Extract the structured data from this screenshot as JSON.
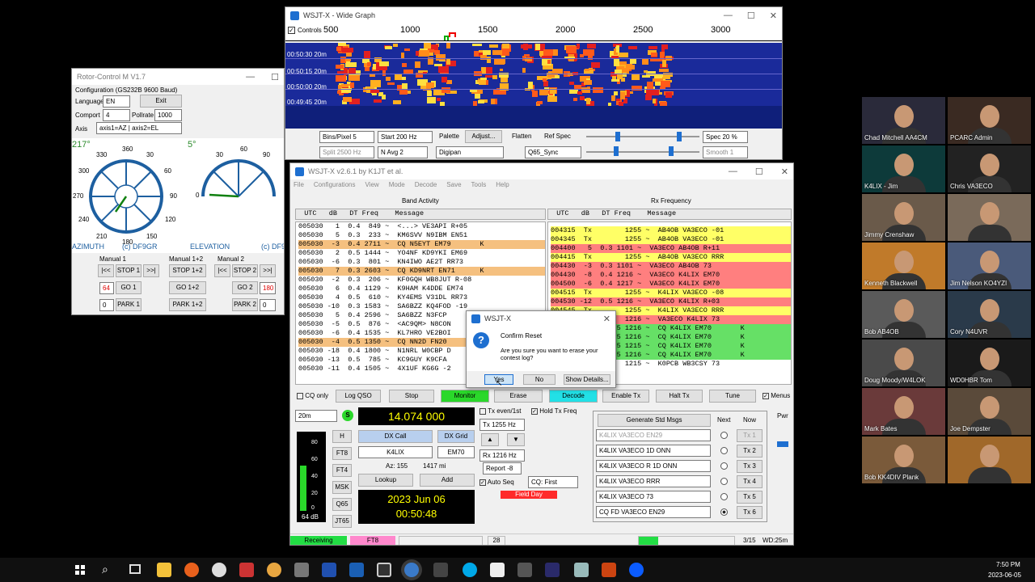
{
  "colors": {
    "row_orange": "#f5c07f",
    "row_yellow": "#ffff66",
    "row_red": "#ff7f7f",
    "row_green": "#66e066",
    "monitor_green": "#2ad82a",
    "decode_cyan": "#22e0e6",
    "field_day_red": "#ff2a2a",
    "receiving_green": "#22dd44",
    "ft8_pink": "#ff88cc",
    "freq_yellow": "#ffff00"
  },
  "widegraph": {
    "title": "WSJT-X - Wide Graph",
    "controls_label": "Controls",
    "scale": [
      "500",
      "1000",
      "1500",
      "2000",
      "2500",
      "3000"
    ],
    "time_labels": [
      "00:50:30  20m",
      "00:50:15  20m",
      "00:50:00  20m",
      "00:49:45  20m"
    ],
    "bins_label": "Bins/Pixel  5",
    "start_label": "Start 200 Hz",
    "palette_label": "Palette",
    "adjust_label": "Adjust...",
    "flatten_label": "Flatten",
    "refspec_label": "Ref Spec",
    "spec_label": "Spec 20 %",
    "split_label": "Split  2500 Hz",
    "navg_label": "N Avg  2",
    "digipan_label": "Digipan",
    "q65_label": "Q65_Sync",
    "smooth_label": "Smooth  1"
  },
  "rotor": {
    "title": "Rotor-Control M V1.7",
    "config": "Configuration (GS232B 9600 Baud)",
    "language_label": "Language",
    "language_value": "EN",
    "exit_label": "Exit",
    "comport_label": "Comport",
    "comport_value": "4",
    "pollrate_label": "Pollrate",
    "pollrate_value": "1000",
    "axis_label": "Axis",
    "axis_value": "axis1=AZ | axis2=EL",
    "az_value": "217°",
    "el_value": "5°",
    "az_ticks": [
      "360",
      "30",
      "60",
      "90",
      "120",
      "150",
      "180",
      "210",
      "240",
      "270",
      "300",
      "330"
    ],
    "el_ticks": [
      "30",
      "60",
      "90",
      "0"
    ],
    "el_right_tick": "0",
    "azimuth_label": "AZIMUTH",
    "copyright1": "(c) DF9GR",
    "elevation_label": "ELEVATION",
    "copyright2": "(c) DF9",
    "manual1": "Manual 1",
    "manual12": "Manual 1+2",
    "manual2": "Manual 2",
    "back_btn": "|<<",
    "fwd_btn": ">>|",
    "stop1": "STOP 1",
    "stop12": "STOP 1+2",
    "stop2": "STOP 2",
    "go1": "GO 1",
    "go12": "GO 1+2",
    "go2": "GO 2",
    "park1": "PARK 1",
    "park12": "PARK 1+2",
    "park2": "PARK 2",
    "val64": "64",
    "val180": "180",
    "val0a": "0",
    "val0b": "0"
  },
  "wsjtx": {
    "title": "WSJT-X  v2.6.1  by K1JT et al.",
    "menu": [
      "File",
      "Configurations",
      "View",
      "Mode",
      "Decode",
      "Save",
      "Tools",
      "Help"
    ],
    "band_activity": "Band Activity",
    "rx_frequency": "Rx Frequency",
    "header": "  UTC   dB   DT Freq    Message",
    "left_rows": [
      {
        "t": "005030   1  0.4  849 ~  <...> VE3API R+05",
        "c": "w"
      },
      {
        "t": "005030   5  0.3  233 ~  KM6SVV N9IBM EN51",
        "c": "w"
      },
      {
        "t": "005030  -3  0.4 2711 ~  CQ N5EYT EM79       K",
        "c": "o"
      },
      {
        "t": "005030   2  0.5 1444 ~  YO4NF KD9YKI EM69",
        "c": "w"
      },
      {
        "t": "005030  -6  0.3  801 ~  KN4IWO AE2T RR73",
        "c": "w"
      },
      {
        "t": "005030   7  0.3 2603 ~  CQ KD9NRT EN71      K",
        "c": "o"
      },
      {
        "t": "005030  -2  0.3  206 ~  KF0GQH WB8JUT R-08",
        "c": "w"
      },
      {
        "t": "005030   6  0.4 1129 ~  K9HAM K4DDE EM74",
        "c": "w"
      },
      {
        "t": "005030   4  0.5  610 ~  KY4EMS V31DL RR73",
        "c": "w"
      },
      {
        "t": "005030 -10  0.3 1583 ~  SA6BZZ KQ4FOD -19",
        "c": "w"
      },
      {
        "t": "005030   5  0.4 2596 ~  SA6BZZ N3FCP",
        "c": "w"
      },
      {
        "t": "005030  -5  0.5  876 ~  <AC9QM> N8CON",
        "c": "w"
      },
      {
        "t": "005030  -6  0.4 1535 ~  KL7HRO VE2BOI",
        "c": "w"
      },
      {
        "t": "005030  -4  0.5 1350 ~  CQ NN2D FN20",
        "c": "o"
      },
      {
        "t": "005030 -18  0.4 1800 ~  N1NRL W0CBP D",
        "c": "w"
      },
      {
        "t": "005030 -13  0.5  785 ~  KC9GUY K9CFA",
        "c": "w"
      },
      {
        "t": "005030 -11  0.4 1505 ~  4X1UF KG6G -2",
        "c": "w"
      }
    ],
    "right_rows": [
      {
        "t": "004315  Tx        1255 ~  AB4OB VA3ECO -01",
        "c": "y"
      },
      {
        "t": "004345  Tx        1255 ~  AB4OB VA3ECO -01",
        "c": "y"
      },
      {
        "t": "004400   5  0.3 1101 ~  VA3ECO AB4OB R+11",
        "c": "r"
      },
      {
        "t": "004415  Tx        1255 ~  AB4OB VA3ECO RRR",
        "c": "y"
      },
      {
        "t": "004430  -3  0.3 1101 ~  VA3ECO AB4OB 73",
        "c": "r"
      },
      {
        "t": "004430  -8  0.4 1216 ~  VA3ECO K4LIX EM70",
        "c": "r"
      },
      {
        "t": "004500  -6  0.4 1217 ~  VA3ECO K4LIX EM70",
        "c": "r"
      },
      {
        "t": "004515  Tx        1255 ~  K4LIX VA3ECO -08",
        "c": "y"
      },
      {
        "t": "004530 -12  0.5 1216 ~  VA3ECO K4LIX R+03",
        "c": "r"
      },
      {
        "t": "004545  Tx        1255 ~  K4LIX VA3ECO RRR",
        "c": "y"
      },
      {
        "t": "                  1216 ~  VA3ECO K4LIX 73",
        "c": "r"
      },
      {
        "t": "                5 1216 ~  CQ K4LIX EM70       K",
        "c": "g"
      },
      {
        "t": "                5 1216 ~  CQ K4LIX EM70       K",
        "c": "g"
      },
      {
        "t": "                5 1215 ~  CQ K4LIX EM70       K",
        "c": "g"
      },
      {
        "t": "                5 1216 ~  CQ K4LIX EM70       K",
        "c": "g"
      },
      {
        "t": "                  1215 ~  K0PCB WB3CSY 73",
        "c": "w"
      }
    ],
    "cq_only": "CQ only",
    "log_qso": "Log QSO",
    "stop": "Stop",
    "monitor": "Monitor",
    "erase": "Erase",
    "decode": "Decode",
    "enable_tx": "Enable Tx",
    "halt_tx": "Halt Tx",
    "tune": "Tune",
    "menus": "Menus",
    "band": "20m",
    "freq": "14.074 000",
    "tx_even": "Tx even/1st",
    "hold_tx": "Hold Tx Freq",
    "tx_freq": "Tx  1255 Hz",
    "rx_freq": "Rx  1216 Hz",
    "report": "Report  -8",
    "auto_seq": "Auto Seq",
    "cq_first": "CQ: First",
    "field_day": "Field Day",
    "h_btn": "H",
    "ft8_btn": "FT8",
    "ft4_btn": "FT4",
    "msk_btn": "MSK",
    "q65_btn": "Q65",
    "jt65_btn": "JT65",
    "db_label": "64 dB",
    "meter_ticks": [
      "80",
      "60",
      "40",
      "20",
      "0"
    ],
    "dx_call_label": "DX Call",
    "dx_grid_label": "DX Grid",
    "dx_call": "K4LIX",
    "dx_grid": "EM70",
    "az": "Az: 155",
    "dist": "1417 mi",
    "lookup": "Lookup",
    "add": "Add",
    "date": "2023 Jun 06",
    "time": "00:50:48",
    "gen_std": "Generate Std Msgs",
    "next": "Next",
    "now": "Now",
    "pwr": "Pwr",
    "tx_msgs": [
      {
        "msg": "K4LIX VA3ECO EN29",
        "btn": "Tx 1"
      },
      {
        "msg": "K4LIX VA3ECO 1D ONN",
        "btn": "Tx 2"
      },
      {
        "msg": "K4LIX VA3ECO R 1D ONN",
        "btn": "Tx 3"
      },
      {
        "msg": "K4LIX VA3ECO RRR",
        "btn": "Tx 4"
      },
      {
        "msg": "K4LIX VA3ECO 73",
        "btn": "Tx 5"
      },
      {
        "msg": "CQ FD VA3ECO EN29",
        "btn": "Tx 6"
      }
    ],
    "status_receiving": "Receiving",
    "status_ft8": "FT8",
    "status_28": "28",
    "status_315": "3/15",
    "status_wd": "WD:25m"
  },
  "dialog": {
    "title": "WSJT-X",
    "heading": "Confirm Reset",
    "text": "Are you sure you want to erase your contest log?",
    "yes": "Yes",
    "no": "No",
    "details": "Show Details..."
  },
  "participants": [
    "Chad Mitchell AA4CM",
    "PCARC Admin",
    "K4LIX - Jim",
    "Chris VA3ECO",
    "Jimmy Crenshaw",
    "",
    "Kenneth Blackwell",
    "Jim Nelson KO4YZI",
    "Bob AB4OB",
    "Cory N4UVR",
    "Doug Moody/W4LOK",
    "WD0HBR Tom",
    "Mark Bates",
    "Joe Dempster",
    "Bob KK4DIV Plank",
    ""
  ],
  "taskbar": {
    "time": "7:50 PM",
    "date": "2023-06-05"
  }
}
